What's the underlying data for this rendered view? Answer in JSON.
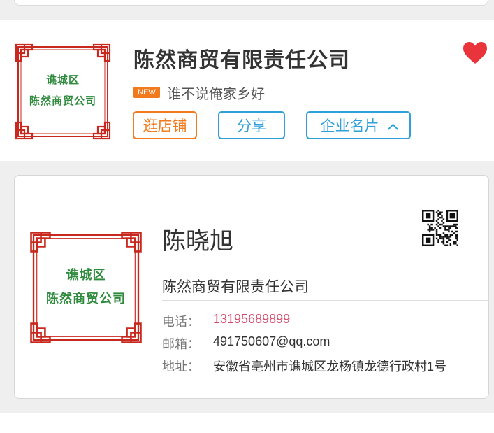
{
  "store": {
    "name": "陈然商贸有限责任公司",
    "logo": {
      "line1": "谯城区",
      "line2": "陈然商贸公司"
    },
    "badge": "NEW",
    "slogan": "谁不说俺家乡好",
    "favorite": true,
    "buttons": {
      "shop": "逛店铺",
      "share": "分享",
      "card": "企业名片"
    }
  },
  "card": {
    "logo": {
      "line1": "谯城区",
      "line2": "陈然商贸公司"
    },
    "person": "陈晓旭",
    "company": "陈然商贸有限责任公司",
    "phone_label": "电话：",
    "phone": "13195689899",
    "email_label": "邮箱：",
    "email": "491750607@qq.com",
    "address_label": "地址：",
    "address": "安徽省亳州市谯城区龙杨镇龙德行政村1号"
  },
  "colors": {
    "accent_orange": "#f07a1d",
    "accent_blue": "#2fa0d8",
    "heart_red": "#e8343a",
    "logo_green": "#2e8a3d",
    "frame_red": "#c8281e",
    "phone_pink": "#d0496a"
  },
  "icons": {
    "favorite": "heart-icon",
    "card_toggle": "chevron-up-icon",
    "qr": "qr-code-icon"
  }
}
